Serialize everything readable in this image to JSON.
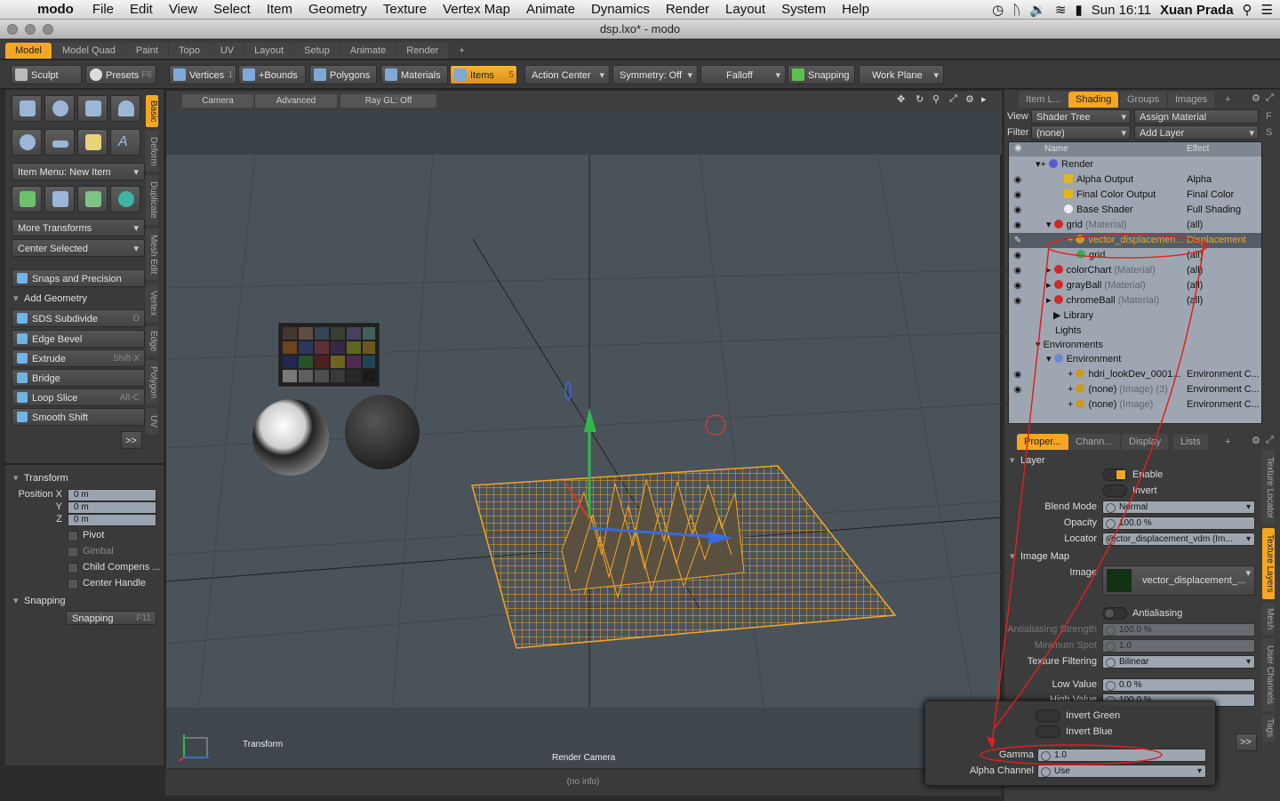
{
  "menubar": {
    "app": "modo",
    "items": [
      "File",
      "Edit",
      "View",
      "Select",
      "Item",
      "Geometry",
      "Texture",
      "Vertex Map",
      "Animate",
      "Dynamics",
      "Render",
      "Layout",
      "System",
      "Help"
    ],
    "clock": "Sun 16:11",
    "user": "Xuan Prada"
  },
  "window": {
    "title": "dsp.lxo* - modo"
  },
  "layout_tabs": [
    "Model",
    "Model Quad",
    "Paint",
    "Topo",
    "UV",
    "Layout",
    "Setup",
    "Animate",
    "Render",
    "+"
  ],
  "toolbar": {
    "sculpt": "Sculpt",
    "presets": "Presets",
    "presets_key": "F6",
    "vertices": "Vertices",
    "vertices_count": "1",
    "bounds": "+Bounds",
    "polygons": "Polygons",
    "materials": "Materials",
    "items": "Items",
    "items_count": "5",
    "action_center": "Action Center",
    "symmetry": "Symmetry: Off",
    "falloff": "Falloff",
    "snapping": "Snapping",
    "work_plane": "Work Plane"
  },
  "left": {
    "item_menu": "Item Menu: New Item",
    "more_transforms": "More Transforms",
    "center_selected": "Center Selected",
    "snaps_precision": "Snaps and Precision",
    "add_geometry": "Add Geometry",
    "tools": [
      {
        "label": "SDS Subdivide",
        "key": "D"
      },
      {
        "label": "Edge Bevel",
        "key": ""
      },
      {
        "label": "Extrude",
        "key": "Shift-X"
      },
      {
        "label": "Bridge",
        "key": ""
      },
      {
        "label": "Loop Slice",
        "key": "Alt-C"
      },
      {
        "label": "Smooth Shift",
        "key": ""
      }
    ],
    "more": ">>",
    "vtabs": [
      "Basic",
      "Deform",
      "Duplicate",
      "Mesh Edit",
      "Vertex",
      "Edge",
      "Polygon",
      "UV"
    ],
    "transform": "Transform",
    "position_label": "Position X",
    "y": "Y",
    "z": "Z",
    "pos_x": "0 m",
    "pos_y": "0 m",
    "pos_z": "0 m",
    "pivot": "Pivot",
    "gimbal": "Gimbal",
    "child_comp": "Child Compens ...",
    "center_handle": "Center Handle",
    "snapping_hdr": "Snapping",
    "snapping_btn": "Snapping",
    "snapping_key": "F11"
  },
  "viewport": {
    "camera": "Camera",
    "shading": "Advanced OpenGL",
    "raygl": "Ray GL: Off",
    "transform_label": "Transform",
    "render_camera": "Render Camera",
    "info": "(no info)"
  },
  "right": {
    "tabs": [
      "Item L...",
      "Shading",
      "Groups",
      "Images",
      "+"
    ],
    "view_label": "View",
    "view_value": "Shader Tree",
    "assign_material": "Assign Material",
    "assign_key": "F",
    "filter_label": "Filter",
    "filter_value": "(none)",
    "add_layer": "Add Layer",
    "add_layer_key": "S",
    "col_name": "Name",
    "col_effect": "Effect",
    "rows": [
      {
        "name": "Render",
        "sub": "",
        "effect": ""
      },
      {
        "name": "Alpha Output",
        "sub": "",
        "effect": "Alpha"
      },
      {
        "name": "Final Color Output",
        "sub": "",
        "effect": "Final Color"
      },
      {
        "name": "Base Shader",
        "sub": "",
        "effect": "Full Shading"
      },
      {
        "name": "grid",
        "sub": "(Material)",
        "effect": "(all)"
      },
      {
        "name": "vector_displacemen...",
        "sub": "",
        "effect": "Displacement"
      },
      {
        "name": "grid",
        "sub": "",
        "effect": "(all)"
      },
      {
        "name": "colorChart",
        "sub": "(Material)",
        "effect": "(all)"
      },
      {
        "name": "grayBall",
        "sub": "(Material)",
        "effect": "(all)"
      },
      {
        "name": "chromeBall",
        "sub": "(Material)",
        "effect": "(all)"
      },
      {
        "name": "Library",
        "sub": "",
        "effect": ""
      },
      {
        "name": "Lights",
        "sub": "",
        "effect": ""
      },
      {
        "name": "Environments",
        "sub": "",
        "effect": ""
      },
      {
        "name": "Environment",
        "sub": "",
        "effect": ""
      },
      {
        "name": "hdri_lookDev_0001...",
        "sub": "",
        "effect": "Environment C..."
      },
      {
        "name": "(none)",
        "sub": "(Image) (3)",
        "effect": "Environment C..."
      },
      {
        "name": "(none)",
        "sub": "(Image)",
        "effect": "Environment C..."
      }
    ],
    "prop_tabs": [
      "Proper...",
      "Chann...",
      "Display",
      "Lists",
      "+"
    ],
    "prop_vtabs": [
      "Texture Locator",
      "Texture Layers",
      "Mesh",
      "User Channels",
      "Tags"
    ],
    "layer": "Layer",
    "enable": "Enable",
    "invert": "Invert",
    "blend_mode_label": "Blend Mode",
    "blend_mode": "Normal",
    "opacity_label": "Opacity",
    "opacity": "100.0 %",
    "locator_label": "Locator",
    "locator": "vector_displacement_vdm (Im...",
    "image_map": "Image Map",
    "image_label": "Image",
    "image": "vector_displacement_...",
    "antialiasing": "Antialiasing",
    "aa_strength_label": "Antialiasing Strength",
    "aa_strength": "100.0 %",
    "min_spot_label": "Minimum Spot",
    "min_spot": "1.0",
    "tex_filter_label": "Texture Filtering",
    "tex_filter": "Bilinear",
    "low_value_label": "Low Value",
    "low_value": "0.0 %",
    "high_value_label": "High Value",
    "high_value": "100.0 %",
    "more": ">>"
  },
  "popup": {
    "invert_green": "Invert Green",
    "invert_blue": "Invert Blue",
    "gamma_label": "Gamma",
    "gamma": "1.0",
    "alpha_label": "Alpha Channel",
    "alpha": "Use"
  },
  "colors": {
    "accent": "#f5a623",
    "annotation": "#e02020"
  }
}
